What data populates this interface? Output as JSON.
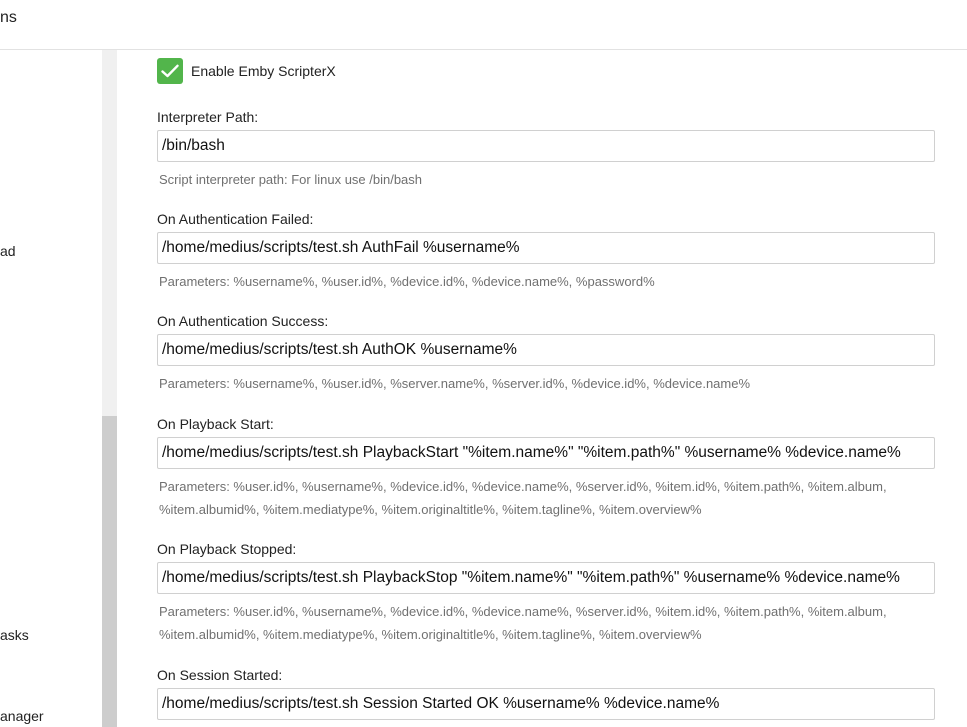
{
  "header": {
    "title_fragment": "ns"
  },
  "sidebar": {
    "items": [
      {
        "label": "ad"
      },
      {
        "label": "asks"
      },
      {
        "label": "anager"
      }
    ]
  },
  "plugin": {
    "enable_checkbox": {
      "label": "Enable Emby ScripterX",
      "checked": true
    },
    "fields": [
      {
        "label": "Interpreter Path:",
        "value": "/bin/bash",
        "help": "Script interpreter path: For linux use /bin/bash"
      },
      {
        "label": "On Authentication Failed:",
        "value": "/home/medius/scripts/test.sh AuthFail %username%",
        "help": "Parameters: %username%, %user.id%, %device.id%, %device.name%, %password%"
      },
      {
        "label": "On Authentication Success:",
        "value": "/home/medius/scripts/test.sh AuthOK %username%",
        "help": "Parameters: %username%, %user.id%, %server.name%, %server.id%, %device.id%, %device.name%"
      },
      {
        "label": "On Playback Start:",
        "value": "/home/medius/scripts/test.sh PlaybackStart \"%item.name%\" \"%item.path%\" %username% %device.name%",
        "help_line1": "Parameters: %user.id%, %username%, %device.id%, %device.name%, %server.id%, %item.id%, %item.path%, %item.album,",
        "help_line2": "%item.albumid%, %item.mediatype%, %item.originaltitle%, %item.tagline%, %item.overview%"
      },
      {
        "label": "On Playback Stopped:",
        "value": "/home/medius/scripts/test.sh PlaybackStop \"%item.name%\" \"%item.path%\" %username% %device.name%",
        "help_line1": "Parameters: %user.id%, %username%, %device.id%, %device.name%, %server.id%, %item.id%, %item.path%, %item.album,",
        "help_line2": "%item.albumid%, %item.mediatype%, %item.originaltitle%, %item.tagline%, %item.overview%"
      },
      {
        "label": "On Session Started:",
        "value": "/home/medius/scripts/test.sh Session Started OK %username% %device.name%"
      }
    ]
  },
  "colors": {
    "checkbox": "#52b54b",
    "help_text": "#707070",
    "input_border": "#d0d0d0"
  }
}
